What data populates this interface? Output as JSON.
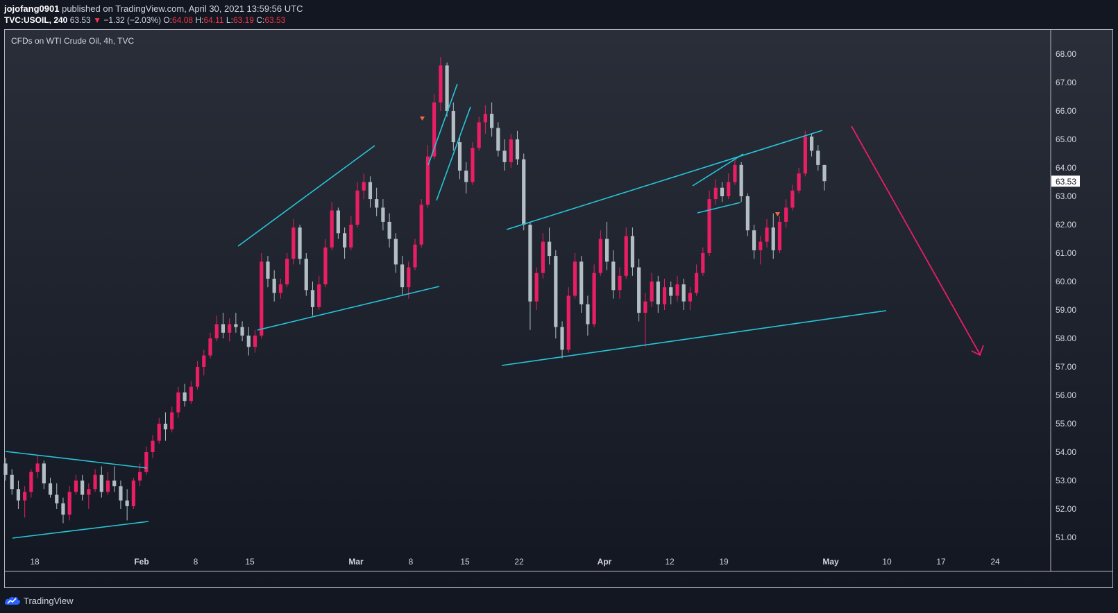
{
  "header": {
    "author": "jojofang0901",
    "published": "published on TradingView.com, April 30, 2021 13:59:56 UTC"
  },
  "symbol_line": {
    "symbol": "TVC:USOIL, 240",
    "last": "63.53",
    "arrow": "▼",
    "change": "−1.32 (−2.03%)",
    "o_label": "O:",
    "o": "64.08",
    "h_label": "H:",
    "h": "64.11",
    "l_label": "L:",
    "l": "63.19",
    "c_label": "C:",
    "c": "63.53"
  },
  "footer": {
    "brand": "TradingView",
    "logo_icon": "tradingview-cloud-icon"
  },
  "colors": {
    "background": "#131722",
    "up_candle": "#e91e63",
    "down_candle": "#b2bec3",
    "trendline": "#26c6da",
    "forecast_arrow": "#e91e63",
    "price_tag_bg": "#ffffff"
  },
  "chart_data": {
    "type": "candlestick",
    "title": "CFDs on WTI Crude Oil, 4h, TVC",
    "x_tick_labels": [
      "18",
      "Feb",
      "8",
      "15",
      "Mar",
      "8",
      "15",
      "22",
      "Apr",
      "12",
      "19",
      "May",
      "10",
      "17",
      "24"
    ],
    "y_tick_labels": [
      "68.00",
      "67.00",
      "66.00",
      "65.00",
      "64.00",
      "63.00",
      "62.00",
      "61.00",
      "60.00",
      "59.00",
      "58.00",
      "57.00",
      "56.00",
      "55.00",
      "54.00",
      "53.00",
      "52.00",
      "51.00"
    ],
    "ylim": [
      50.5,
      68.6
    ],
    "current_price_label": "63.53",
    "series": [
      {
        "values": [
          [
            53.6,
            53.8,
            53.0,
            53.2
          ],
          [
            53.2,
            53.4,
            52.5,
            52.7
          ],
          [
            52.7,
            53.0,
            52.0,
            52.3
          ],
          [
            52.3,
            52.8,
            51.7,
            52.6
          ],
          [
            52.6,
            53.4,
            52.4,
            53.3
          ],
          [
            53.3,
            53.9,
            53.1,
            53.6
          ],
          [
            53.6,
            53.7,
            52.7,
            52.9
          ],
          [
            52.9,
            53.1,
            52.4,
            52.5
          ],
          [
            52.5,
            52.9,
            52.0,
            52.2
          ],
          [
            52.2,
            52.4,
            51.5,
            51.8
          ],
          [
            51.8,
            52.8,
            51.6,
            52.6
          ],
          [
            52.6,
            53.2,
            52.5,
            53.0
          ],
          [
            53.0,
            53.2,
            52.3,
            52.5
          ],
          [
            52.5,
            52.9,
            52.0,
            52.7
          ],
          [
            52.7,
            53.4,
            52.6,
            53.2
          ],
          [
            53.2,
            53.5,
            52.4,
            52.6
          ],
          [
            52.6,
            53.3,
            52.5,
            53.0
          ],
          [
            53.0,
            53.5,
            52.6,
            52.8
          ],
          [
            52.8,
            53.0,
            52.0,
            52.3
          ],
          [
            52.3,
            52.7,
            51.6,
            52.1
          ],
          [
            52.1,
            53.1,
            52.0,
            53.0
          ],
          [
            53.0,
            53.6,
            52.8,
            53.3
          ],
          [
            53.3,
            54.2,
            53.2,
            54.0
          ],
          [
            54.0,
            54.6,
            53.8,
            54.4
          ],
          [
            54.4,
            55.2,
            54.3,
            55.0
          ],
          [
            55.0,
            55.4,
            54.4,
            54.8
          ],
          [
            54.8,
            55.6,
            54.7,
            55.4
          ],
          [
            55.4,
            56.3,
            55.2,
            56.1
          ],
          [
            56.1,
            56.4,
            55.6,
            55.8
          ],
          [
            55.8,
            56.5,
            55.7,
            56.3
          ],
          [
            56.3,
            57.2,
            56.2,
            57.0
          ],
          [
            57.0,
            57.6,
            56.7,
            57.4
          ],
          [
            57.4,
            58.2,
            57.3,
            58.0
          ],
          [
            58.0,
            58.8,
            57.9,
            58.5
          ],
          [
            58.5,
            58.9,
            58.0,
            58.2
          ],
          [
            58.2,
            58.7,
            57.9,
            58.5
          ],
          [
            58.5,
            58.9,
            58.2,
            58.4
          ],
          [
            58.4,
            58.6,
            57.9,
            58.1
          ],
          [
            58.1,
            58.4,
            57.4,
            57.7
          ],
          [
            57.7,
            58.3,
            57.5,
            58.1
          ],
          [
            58.1,
            61.0,
            58.0,
            60.7
          ],
          [
            60.7,
            60.9,
            59.8,
            60.1
          ],
          [
            60.1,
            60.4,
            59.3,
            59.6
          ],
          [
            59.6,
            60.1,
            59.4,
            59.9
          ],
          [
            59.9,
            61.0,
            59.8,
            60.8
          ],
          [
            60.8,
            62.2,
            60.6,
            61.9
          ],
          [
            61.9,
            62.0,
            60.6,
            60.8
          ],
          [
            60.8,
            61.0,
            59.5,
            59.7
          ],
          [
            59.7,
            60.0,
            58.8,
            59.1
          ],
          [
            59.1,
            60.2,
            59.0,
            59.9
          ],
          [
            59.9,
            61.5,
            59.8,
            61.2
          ],
          [
            61.2,
            62.8,
            61.1,
            62.5
          ],
          [
            62.5,
            62.6,
            61.5,
            61.7
          ],
          [
            61.7,
            61.9,
            60.8,
            61.2
          ],
          [
            61.2,
            62.3,
            61.1,
            62.0
          ],
          [
            62.0,
            63.5,
            61.9,
            63.2
          ],
          [
            63.2,
            63.8,
            62.9,
            63.5
          ],
          [
            63.5,
            63.7,
            62.6,
            62.9
          ],
          [
            62.9,
            63.3,
            62.3,
            62.6
          ],
          [
            62.6,
            62.9,
            61.8,
            62.1
          ],
          [
            62.1,
            62.4,
            61.2,
            61.5
          ],
          [
            61.5,
            61.7,
            60.3,
            60.6
          ],
          [
            60.6,
            60.9,
            59.5,
            59.8
          ],
          [
            59.8,
            60.7,
            59.4,
            60.5
          ],
          [
            60.5,
            61.5,
            60.4,
            61.3
          ],
          [
            61.3,
            62.9,
            61.2,
            62.7
          ],
          [
            62.7,
            64.8,
            62.6,
            64.4
          ],
          [
            64.4,
            66.6,
            64.3,
            66.3
          ],
          [
            66.3,
            67.9,
            66.0,
            67.6
          ],
          [
            67.6,
            67.7,
            65.8,
            66.0
          ],
          [
            66.0,
            66.3,
            64.6,
            64.9
          ],
          [
            64.9,
            65.1,
            63.6,
            63.9
          ],
          [
            63.9,
            64.2,
            63.1,
            63.5
          ],
          [
            63.5,
            64.9,
            63.4,
            64.7
          ],
          [
            64.7,
            65.8,
            64.6,
            65.6
          ],
          [
            65.6,
            66.2,
            65.2,
            65.9
          ],
          [
            65.9,
            66.3,
            65.1,
            65.4
          ],
          [
            65.4,
            65.6,
            64.4,
            64.6
          ],
          [
            64.6,
            65.0,
            63.9,
            64.2
          ],
          [
            64.2,
            65.2,
            64.0,
            65.0
          ],
          [
            65.0,
            65.3,
            64.1,
            64.3
          ],
          [
            64.3,
            64.5,
            61.8,
            62.0
          ],
          [
            62.0,
            62.1,
            58.3,
            59.3
          ],
          [
            59.3,
            60.5,
            59.0,
            60.3
          ],
          [
            60.3,
            61.7,
            60.1,
            61.4
          ],
          [
            61.4,
            61.9,
            60.6,
            60.9
          ],
          [
            60.9,
            61.1,
            58.0,
            58.4
          ],
          [
            58.4,
            58.6,
            57.3,
            57.6
          ],
          [
            57.6,
            59.8,
            57.5,
            59.5
          ],
          [
            59.5,
            61.0,
            59.4,
            60.7
          ],
          [
            60.7,
            60.9,
            58.9,
            59.2
          ],
          [
            59.2,
            59.5,
            58.1,
            58.5
          ],
          [
            58.5,
            60.6,
            58.4,
            60.3
          ],
          [
            60.3,
            61.8,
            60.2,
            61.5
          ],
          [
            61.5,
            62.1,
            60.4,
            60.7
          ],
          [
            60.7,
            61.1,
            59.4,
            59.7
          ],
          [
            59.7,
            60.5,
            59.4,
            60.2
          ],
          [
            60.2,
            61.9,
            60.1,
            61.6
          ],
          [
            61.6,
            61.9,
            60.2,
            60.5
          ],
          [
            60.5,
            60.8,
            58.6,
            58.9
          ],
          [
            58.9,
            59.6,
            57.7,
            59.3
          ],
          [
            59.3,
            60.3,
            59.1,
            60.0
          ],
          [
            60.0,
            60.2,
            58.9,
            59.2
          ],
          [
            59.2,
            60.1,
            59.0,
            59.8
          ],
          [
            59.8,
            60.0,
            59.2,
            59.5
          ],
          [
            59.5,
            60.2,
            59.3,
            59.9
          ],
          [
            59.9,
            60.1,
            59.0,
            59.3
          ],
          [
            59.3,
            59.8,
            59.0,
            59.6
          ],
          [
            59.6,
            60.6,
            59.5,
            60.3
          ],
          [
            60.3,
            61.2,
            60.2,
            61.0
          ],
          [
            61.0,
            63.2,
            60.9,
            62.9
          ],
          [
            62.9,
            63.6,
            62.7,
            63.3
          ],
          [
            63.3,
            63.5,
            62.8,
            63.0
          ],
          [
            63.0,
            63.8,
            62.9,
            63.5
          ],
          [
            63.5,
            64.3,
            63.4,
            64.1
          ],
          [
            64.1,
            64.2,
            62.8,
            63.0
          ],
          [
            63.0,
            63.1,
            61.6,
            61.8
          ],
          [
            61.8,
            62.0,
            60.8,
            61.1
          ],
          [
            61.1,
            61.6,
            60.6,
            61.4
          ],
          [
            61.4,
            62.2,
            61.2,
            61.9
          ],
          [
            61.9,
            62.4,
            60.8,
            61.1
          ],
          [
            61.1,
            62.3,
            61.0,
            62.1
          ],
          [
            62.1,
            62.9,
            61.9,
            62.6
          ],
          [
            62.6,
            63.4,
            62.5,
            63.2
          ],
          [
            63.2,
            64.0,
            63.1,
            63.8
          ],
          [
            63.8,
            65.3,
            63.7,
            65.1
          ],
          [
            65.1,
            65.2,
            64.4,
            64.6
          ],
          [
            64.6,
            64.8,
            63.9,
            64.1
          ],
          [
            64.1,
            64.1,
            63.2,
            63.53
          ]
        ]
      }
    ]
  }
}
